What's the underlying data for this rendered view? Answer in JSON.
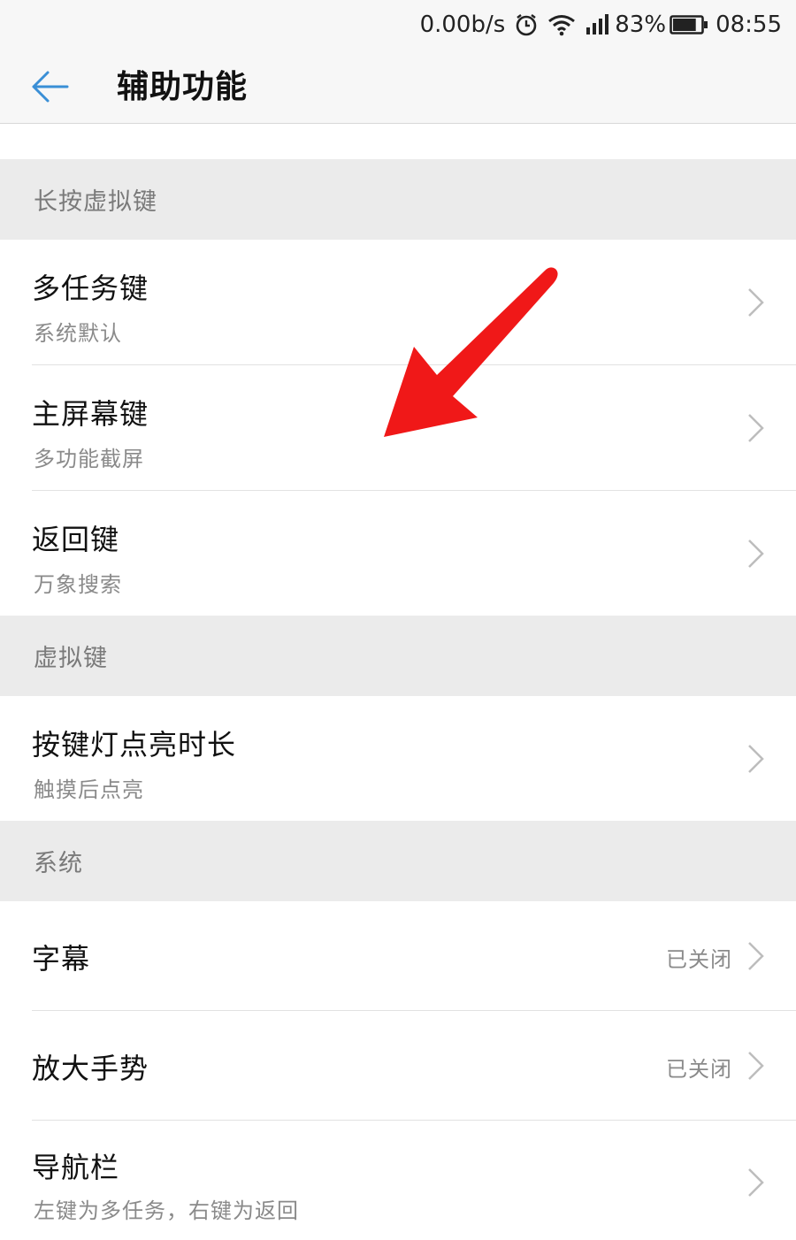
{
  "status_bar": {
    "network_speed": "0.00b/s",
    "signal_icon": "signal-icon",
    "wifi_icon": "wifi-icon",
    "alarm_icon": "alarm-icon",
    "battery_percent": "83%",
    "battery_level": 0.83,
    "time": "08:55"
  },
  "app_bar": {
    "title": "辅助功能",
    "back_icon": "arrow-left-icon",
    "accent_color": "#3a8fd6"
  },
  "sections": {
    "long_press": {
      "header": "长按虚拟键",
      "items": [
        {
          "title": "多任务键",
          "subtitle": "系统默认"
        },
        {
          "title": "主屏幕键",
          "subtitle": "多功能截屏"
        },
        {
          "title": "返回键",
          "subtitle": "万象搜索"
        }
      ]
    },
    "virtual_keys": {
      "header": "虚拟键",
      "items": [
        {
          "title": "按键灯点亮时长",
          "subtitle": "触摸后点亮"
        }
      ]
    },
    "system": {
      "header": "系统",
      "items": [
        {
          "title": "字幕",
          "value": "已关闭"
        },
        {
          "title": "放大手势",
          "value": "已关闭"
        },
        {
          "title": "导航栏",
          "subtitle": "左键为多任务，右键为返回"
        }
      ]
    }
  },
  "annotation": {
    "arrow_color": "#f01818",
    "icon": "red-arrow-icon"
  }
}
